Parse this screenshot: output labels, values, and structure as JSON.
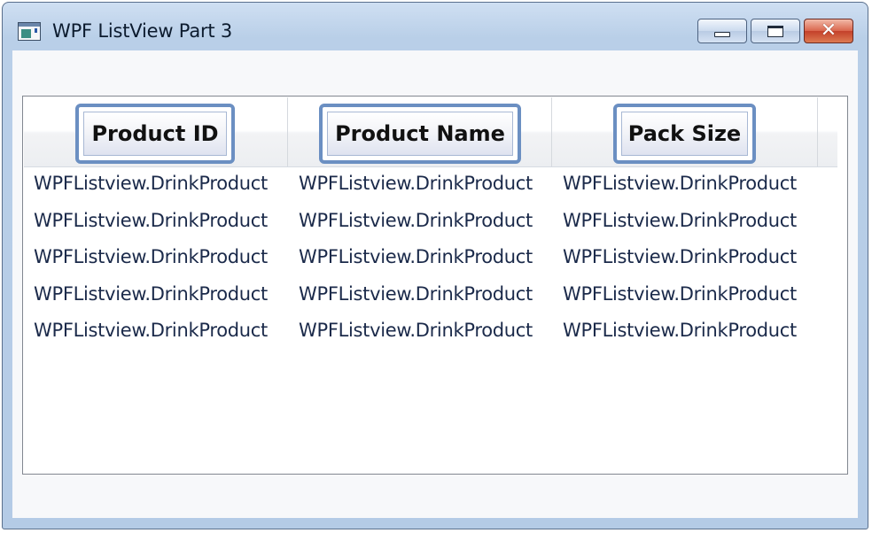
{
  "window": {
    "title": "WPF ListView Part 3",
    "icon": "app-window-icon"
  },
  "caption_buttons": {
    "minimize": "minimize-icon",
    "maximize": "maximize-icon",
    "close": "✕"
  },
  "listview": {
    "columns": [
      {
        "label": "Product ID"
      },
      {
        "label": "Product Name"
      },
      {
        "label": "Pack Size"
      }
    ],
    "rows": [
      [
        "WPFListview.DrinkProduct",
        "WPFListview.DrinkProduct",
        "WPFListview.DrinkProduct"
      ],
      [
        "WPFListview.DrinkProduct",
        "WPFListview.DrinkProduct",
        "WPFListview.DrinkProduct"
      ],
      [
        "WPFListview.DrinkProduct",
        "WPFListview.DrinkProduct",
        "WPFListview.DrinkProduct"
      ],
      [
        "WPFListview.DrinkProduct",
        "WPFListview.DrinkProduct",
        "WPFListview.DrinkProduct"
      ],
      [
        "WPFListview.DrinkProduct",
        "WPFListview.DrinkProduct",
        "WPFListview.DrinkProduct"
      ]
    ]
  },
  "colors": {
    "header_button_border": "#6b8fc2",
    "cell_text": "#1b2a4a",
    "close_button": "#c4402a"
  }
}
